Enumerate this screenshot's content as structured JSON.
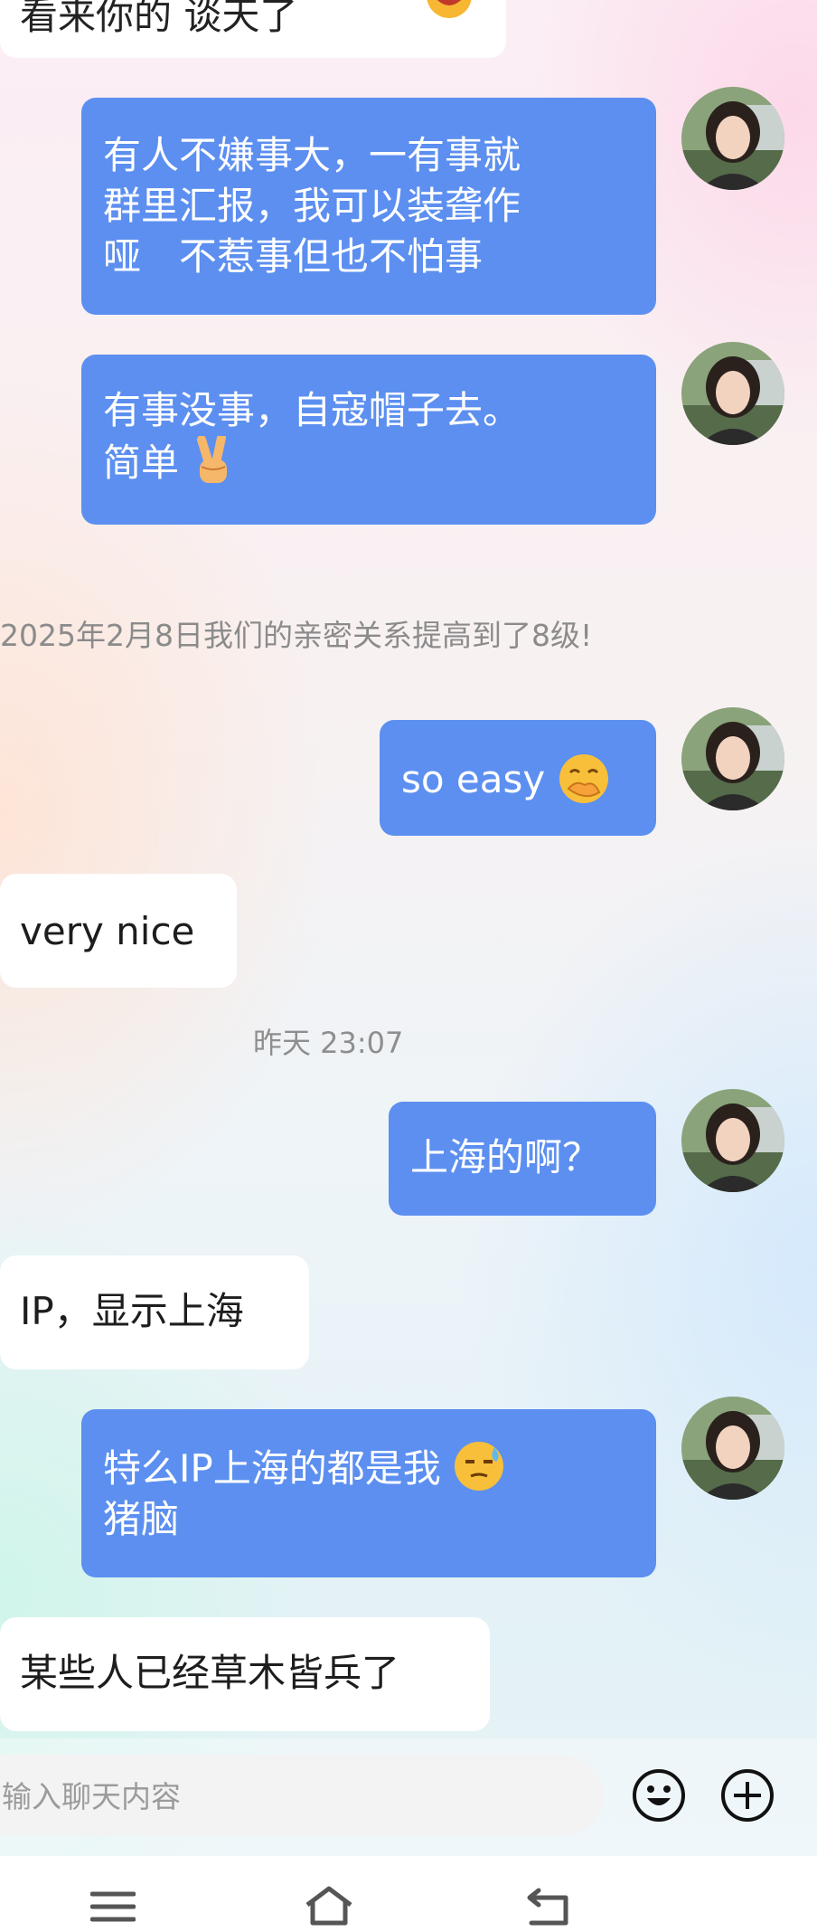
{
  "chat": {
    "partial_top_message": "看来你的 谈天了",
    "messages": [
      {
        "id": "m1",
        "lines": [
          "有人不嫌事大，一有事就",
          "群里汇报，我可以装聋作",
          "哑　不惹事但也不怕事"
        ]
      },
      {
        "id": "m2",
        "lines": [
          "有事没事，自寇帽子去。",
          "简单"
        ],
        "emoji": "victory-hand"
      },
      {
        "id": "m3",
        "text": "so  easy",
        "emoji": "face-with-hand-over-mouth"
      },
      {
        "id": "m4",
        "text": "very nice"
      },
      {
        "id": "m5",
        "text": "上海的啊？"
      },
      {
        "id": "m6",
        "text": "IP，显示上海"
      },
      {
        "id": "m7",
        "lines": [
          "特么IP上海的都是我",
          "猪脑"
        ],
        "emoji": "sweat-face"
      },
      {
        "id": "m8",
        "text": "某些人已经草木皆兵了"
      }
    ],
    "system_intimacy": "2025年2月8日我们的亲密关系提高到了8级!",
    "timestamp": "昨天 23:07"
  },
  "composer": {
    "placeholder": "输入聊天内容"
  },
  "colors": {
    "outgoing_bubble": "#5c8ff0",
    "incoming_bubble": "#ffffff",
    "system_text": "#8e8e8e"
  },
  "icons": {
    "emoji_button": "smiley-face-icon",
    "plus_button": "plus-circle-icon",
    "nav": [
      "menu-icon",
      "home-icon",
      "back-icon"
    ]
  }
}
